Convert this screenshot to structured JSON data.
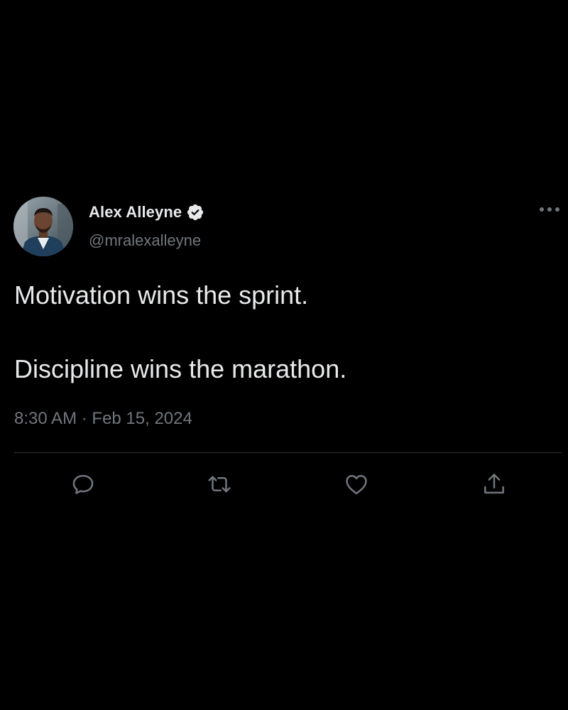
{
  "tweet": {
    "author": {
      "display_name": "Alex Alleyne",
      "handle": "@mralexalleyne",
      "verified": true,
      "avatar_icon": "profile-photo"
    },
    "more_icon": "ellipsis-icon",
    "text_lines": [
      "Motivation wins the sprint.",
      "Discipline wins the marathon."
    ],
    "time": "8:30 AM",
    "separator": "·",
    "date": "Feb 15, 2024",
    "actions": [
      {
        "name": "reply",
        "icon": "reply-icon"
      },
      {
        "name": "retweet",
        "icon": "retweet-icon"
      },
      {
        "name": "like",
        "icon": "heart-icon"
      },
      {
        "name": "share",
        "icon": "share-icon"
      }
    ]
  },
  "colors": {
    "background": "#000000",
    "primary_text": "#e7e9ea",
    "secondary_text": "#71767b",
    "divider": "#2f3336",
    "verified_badge": "#e7e9ea"
  }
}
